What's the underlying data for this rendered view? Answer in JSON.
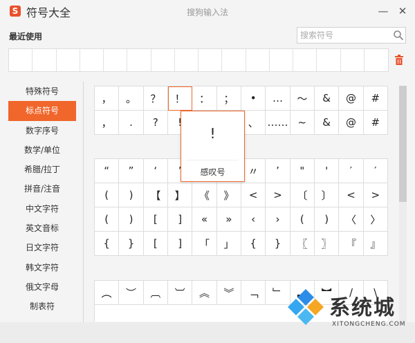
{
  "titlebar": {
    "logo_glyph": "S",
    "app_title": "符号大全",
    "window_title": "搜狗输入法",
    "minimize_glyph": "—",
    "close_glyph": "✕"
  },
  "recent": {
    "label": "最近使用",
    "slot_count": 16
  },
  "search": {
    "placeholder": "搜索符号",
    "value": ""
  },
  "categories": [
    {
      "label": "特殊符号",
      "active": false
    },
    {
      "label": "标点符号",
      "active": true
    },
    {
      "label": "数字序号",
      "active": false
    },
    {
      "label": "数学/单位",
      "active": false
    },
    {
      "label": "希腊/拉丁",
      "active": false
    },
    {
      "label": "拼音/注音",
      "active": false
    },
    {
      "label": "中文字符",
      "active": false
    },
    {
      "label": "英文音标",
      "active": false
    },
    {
      "label": "日文字符",
      "active": false
    },
    {
      "label": "韩文字符",
      "active": false
    },
    {
      "label": "俄文字母",
      "active": false
    },
    {
      "label": "制表符",
      "active": false
    }
  ],
  "symbol_grids": {
    "group_a": [
      [
        "，",
        "。",
        "？",
        "！",
        "：",
        "；",
        "•",
        "…",
        "～",
        "&",
        "@",
        "#"
      ],
      [
        "，",
        ".",
        "?",
        "!",
        ":",
        ";",
        "、",
        "……",
        "~",
        "&",
        "@",
        "#"
      ]
    ],
    "group_b": [
      [
        "“",
        "”",
        "‘",
        "’",
        "〝",
        "〞",
        "〃",
        "’",
        "\"",
        "'",
        "′",
        "′"
      ],
      [
        "(",
        ")",
        "【",
        "】",
        "《",
        "》",
        "<",
        ">",
        "〔",
        "〕",
        "<",
        ">"
      ],
      [
        "(",
        ")",
        "[",
        "]",
        "«",
        "»",
        "‹",
        "›",
        "(",
        ")",
        "〈",
        "〉"
      ],
      [
        "{",
        "}",
        "[",
        "]",
        "「",
        "」",
        "{",
        "}",
        "〖",
        "〗",
        "『",
        "』"
      ]
    ],
    "group_c": [
      [
        "︵",
        "︶",
        "︹",
        "︺",
        "︽",
        "︾",
        "﹁",
        "﹂",
        "︻",
        "︼",
        "/",
        "\\"
      ]
    ]
  },
  "popup": {
    "symbol": "!",
    "name": "感叹号"
  },
  "selected_cell": {
    "grid": "group_a",
    "row": 0,
    "col": 3
  },
  "watermark": {
    "text": "系统城",
    "subtext": "XITONGCHENG.COM"
  },
  "colors": {
    "accent": "#f0662b",
    "logo": "#e8512b",
    "trash": "#e8512b"
  }
}
